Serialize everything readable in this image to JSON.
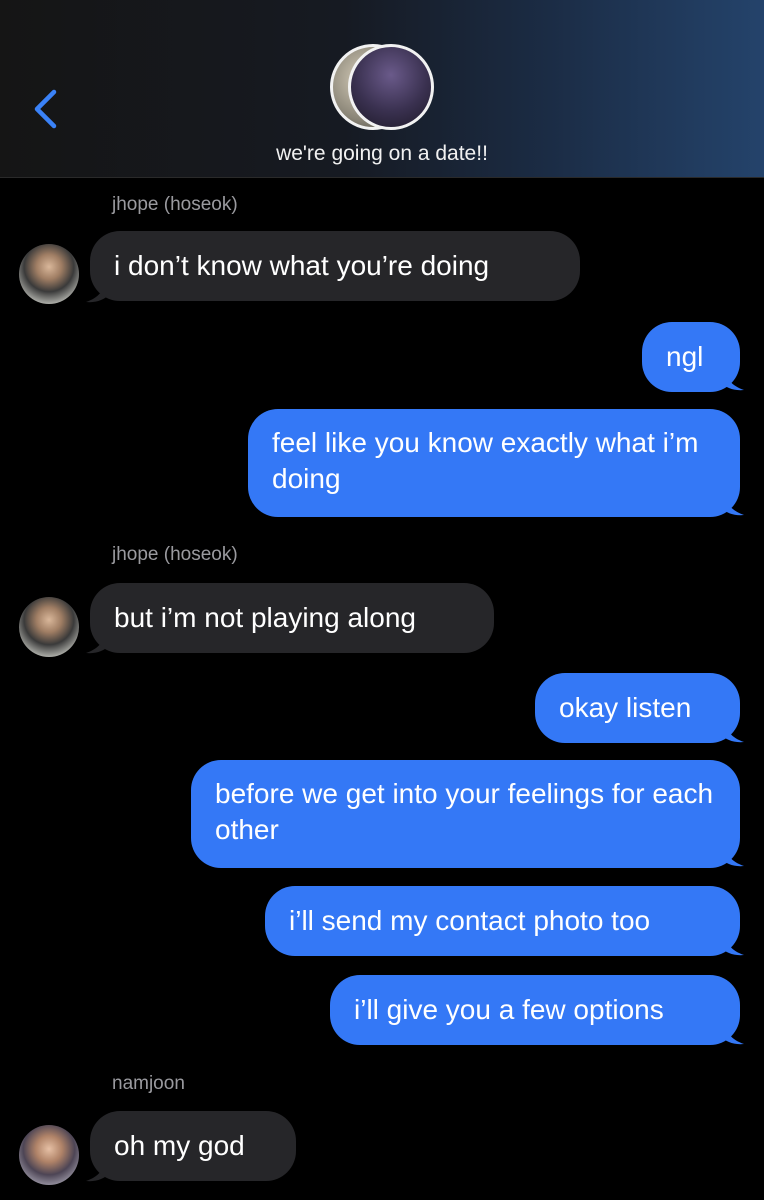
{
  "header": {
    "back_icon": "chevron-left-icon",
    "group_name": "we're going on a date!!",
    "accent_color": "#3478f6"
  },
  "messages": [
    {
      "type": "sender",
      "text": "jhope (hoseok)"
    },
    {
      "type": "in",
      "text": "i don’t know what you’re doing",
      "avatar": "jhope"
    },
    {
      "type": "out",
      "text": "ngl"
    },
    {
      "type": "out",
      "text": "feel like you know exactly what i’m doing"
    },
    {
      "type": "sender",
      "text": "jhope (hoseok)"
    },
    {
      "type": "in",
      "text": "but i’m not playing along",
      "avatar": "jhope"
    },
    {
      "type": "out",
      "text": "okay listen"
    },
    {
      "type": "out",
      "text": "before we get into your feelings for each other"
    },
    {
      "type": "out",
      "text": "i’ll send my contact photo too"
    },
    {
      "type": "out",
      "text": "i’ll give you a few options"
    },
    {
      "type": "sender",
      "text": "namjoon"
    },
    {
      "type": "in",
      "text": "oh my god",
      "avatar": "namjoon"
    }
  ],
  "colors": {
    "incoming_bubble": "#262629",
    "outgoing_bubble": "#3478f6",
    "sender_name": "#9a9a9f"
  }
}
